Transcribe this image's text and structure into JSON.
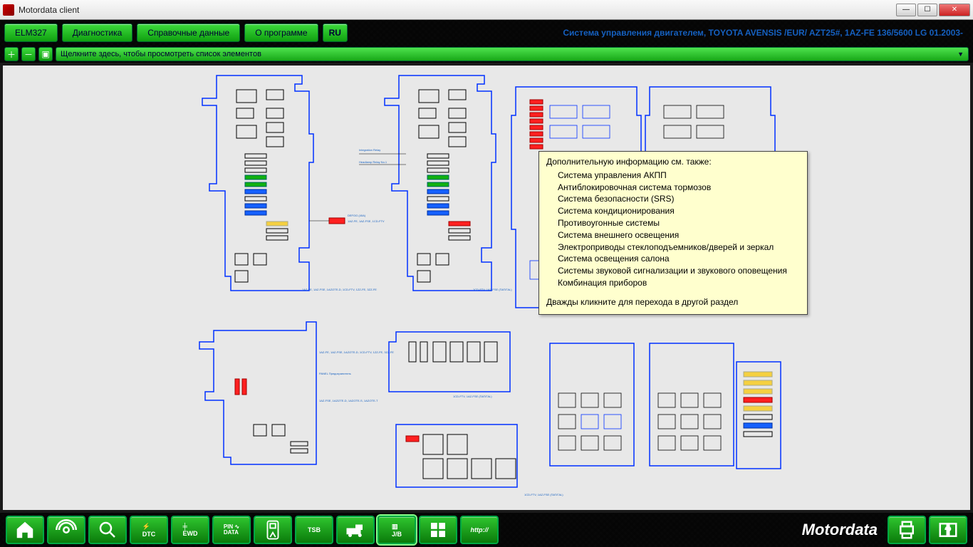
{
  "window": {
    "title": "Motordata client"
  },
  "nav": {
    "elm": "ELM327",
    "diag": "Диагностика",
    "ref": "Справочные данные",
    "about": "О программе",
    "lang": "RU",
    "context": "Система управления двигателем, TOYOTA  AVENSIS /EUR/  AZT25#,   1AZ-FE  136/5600  LG  01.2003-"
  },
  "subbar": {
    "hint": "Щелкните здесь, чтобы просмотреть список элементов"
  },
  "tooltip": {
    "header": "Дополнительную информацию см. также:",
    "items": [
      "Система управления АКПП",
      "Антиблокировочная система тормозов",
      "Система безопасности (SRS)",
      "Система кондиционирования",
      "Противоугонные системы",
      "Система внешнего освещения",
      "Электроприводы стеклоподъемников/дверей и зеркал",
      "Система освещения салона",
      "Системы звуковой сигнализации и звукового оповещения",
      "Комбинация приборов"
    ],
    "footer": "Дважды кликните для перехода в другой раздел"
  },
  "bottom": {
    "home": "home",
    "sig": "sig",
    "lens": "lens",
    "dtc": "DTC",
    "ewd": "EWD",
    "pin": "PIN\nDATA",
    "met": "met",
    "tsb": "TSB",
    "van": "van",
    "jb": "J/B",
    "grid": "grid",
    "http": "http://"
  },
  "brand": "Motordata"
}
